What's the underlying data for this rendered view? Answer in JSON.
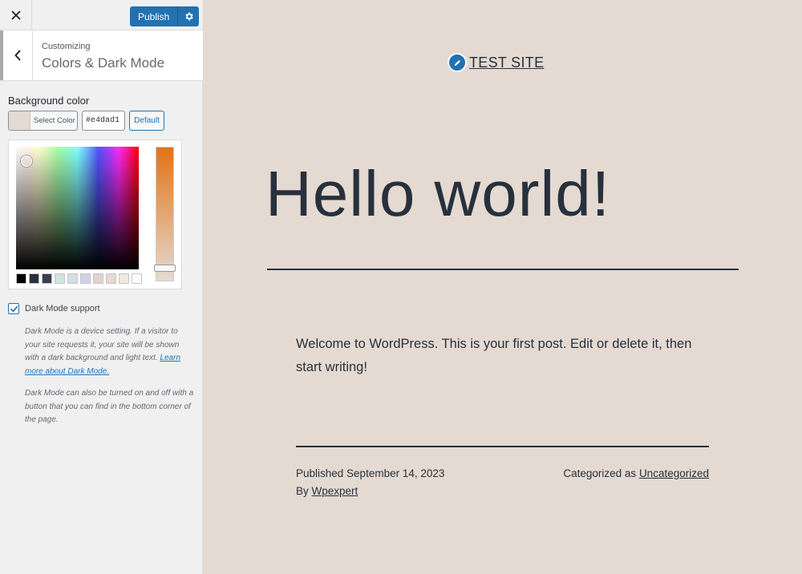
{
  "topbar": {
    "close_icon": "close-icon",
    "publish_label": "Publish",
    "settings_icon": "gear-icon"
  },
  "section": {
    "breadcrumb": "Customizing",
    "title": "Colors & Dark Mode",
    "back_icon": "chevron-left-icon"
  },
  "background_color": {
    "label": "Background color",
    "select_label": "Select Color",
    "hex_value": "#e4dad1",
    "default_label": "Default",
    "current_color": "#e4dad1",
    "hue_top_color": "#e27316",
    "palette": [
      "#000000",
      "#28303d",
      "#39414d",
      "#d1e4dd",
      "#d1dfe4",
      "#d1d1e4",
      "#e4d1d1",
      "#e4dad1",
      "#eeeadd",
      "#ffffff"
    ]
  },
  "dark_mode": {
    "label": "Dark Mode support",
    "checked": true,
    "desc1_text": "Dark Mode is a device setting. If a visitor to your site requests it, your site will be shown with a dark background and light text. ",
    "desc1_link": "Learn more about Dark Mode.",
    "desc2": "Dark Mode can also be turned on and off with a button that you can find in the bottom corner of the page."
  },
  "preview": {
    "site_title": "TEST SITE",
    "site_icon": "pencil-icon",
    "post_title": "Hello world!",
    "post_body": "Welcome to WordPress. This is your first post. Edit or delete it, then start writing!",
    "published_prefix": "Published ",
    "published_date": "September 14, 2023",
    "author_prefix": "By ",
    "author": "Wpexpert",
    "category_prefix": "Categorized as ",
    "category": "Uncategorized",
    "text_color": "#28303d"
  }
}
